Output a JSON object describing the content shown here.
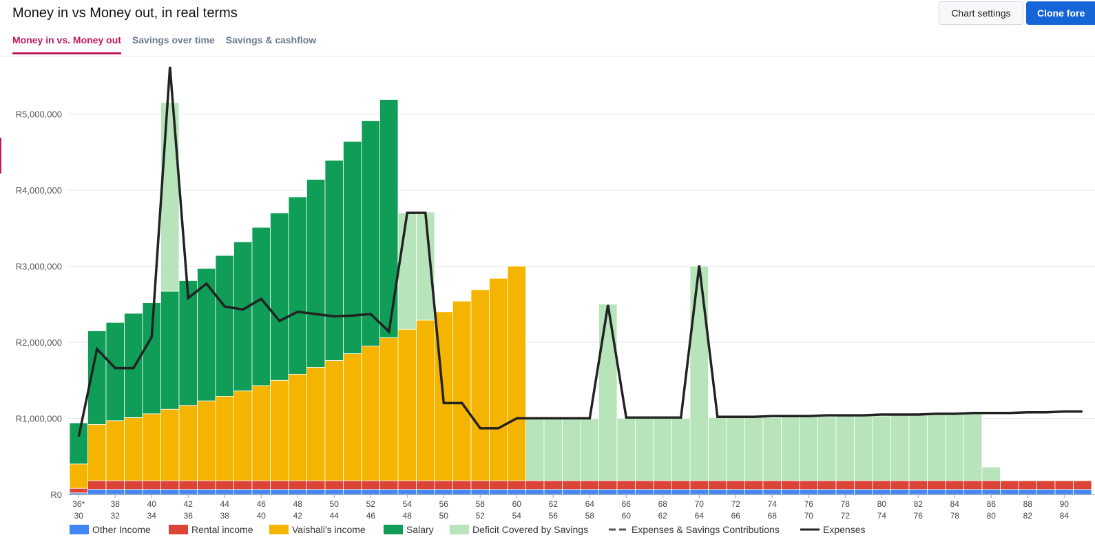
{
  "header": {
    "title": "Money in vs Money out, in real terms",
    "settings_label": "Chart settings",
    "clone_label": "Clone fore"
  },
  "tabs": [
    {
      "label": "Money in vs. Money out",
      "active": true
    },
    {
      "label": "Savings over time",
      "active": false
    },
    {
      "label": "Savings & cashflow",
      "active": false
    }
  ],
  "colors": {
    "other_income": "#4285f4",
    "rental_income": "#db4437",
    "vaishali_income": "#f4b400",
    "salary": "#0f9d58",
    "deficit": "#b7e4bb",
    "expenses": "#222222",
    "accent": "#c2185b",
    "button_primary": "#1565d8"
  },
  "chart_data": {
    "type": "bar",
    "title": "Money in vs Money out, in real terms",
    "ylim": [
      0,
      5700000
    ],
    "yticks": [
      {
        "value": 0,
        "label": "R0"
      },
      {
        "value": 1000000,
        "label": "R1,000,000"
      },
      {
        "value": 2000000,
        "label": "R2,000,000"
      },
      {
        "value": 3000000,
        "label": "R3,000,000"
      },
      {
        "value": 4000000,
        "label": "R4,000,000"
      },
      {
        "value": 5000000,
        "label": "R5,000,000"
      }
    ],
    "ages": [
      36,
      37,
      38,
      39,
      40,
      41,
      42,
      43,
      44,
      45,
      46,
      47,
      48,
      49,
      50,
      51,
      52,
      53,
      54,
      55,
      56,
      57,
      58,
      59,
      60,
      61,
      62,
      63,
      64,
      65,
      66,
      67,
      68,
      69,
      70,
      71,
      72,
      73,
      74,
      75,
      76,
      77,
      78,
      79,
      80,
      81,
      82,
      83,
      84,
      85,
      86,
      87,
      88,
      89,
      90,
      91
    ],
    "xtick_labels_top": [
      "36*",
      "38",
      "40",
      "42",
      "44",
      "46",
      "48",
      "50",
      "52",
      "54",
      "56",
      "58",
      "60",
      "62",
      "64",
      "66",
      "68",
      "70",
      "72",
      "74",
      "76",
      "78",
      "80",
      "82",
      "84",
      "86",
      "88",
      "90"
    ],
    "xtick_labels_bottom": [
      "30",
      "32",
      "34",
      "36",
      "38",
      "40",
      "42",
      "44",
      "46",
      "48",
      "50",
      "52",
      "54",
      "56",
      "58",
      "60",
      "62",
      "64",
      "66",
      "68",
      "70",
      "72",
      "74",
      "76",
      "78",
      "80",
      "82",
      "84"
    ],
    "series": [
      {
        "name": "Other Income",
        "values": [
          20000,
          65000,
          65000,
          65000,
          65000,
          65000,
          65000,
          65000,
          65000,
          65000,
          65000,
          65000,
          65000,
          65000,
          65000,
          65000,
          65000,
          65000,
          65000,
          65000,
          65000,
          65000,
          65000,
          65000,
          65000,
          65000,
          65000,
          65000,
          65000,
          65000,
          65000,
          65000,
          65000,
          65000,
          65000,
          65000,
          65000,
          65000,
          65000,
          65000,
          65000,
          65000,
          65000,
          65000,
          65000,
          65000,
          65000,
          65000,
          65000,
          65000,
          65000,
          65000,
          65000,
          65000,
          65000,
          65000
        ]
      },
      {
        "name": "Rental income",
        "values": [
          60000,
          115000,
          115000,
          115000,
          115000,
          115000,
          115000,
          115000,
          115000,
          115000,
          115000,
          115000,
          115000,
          115000,
          115000,
          115000,
          115000,
          115000,
          115000,
          115000,
          115000,
          115000,
          115000,
          115000,
          115000,
          115000,
          115000,
          115000,
          115000,
          115000,
          115000,
          115000,
          115000,
          115000,
          115000,
          115000,
          115000,
          115000,
          115000,
          115000,
          115000,
          115000,
          115000,
          115000,
          115000,
          115000,
          115000,
          115000,
          115000,
          115000,
          115000,
          115000,
          115000,
          115000,
          115000,
          115000
        ]
      },
      {
        "name": "Vaishali's income",
        "values": [
          320000,
          740000,
          790000,
          830000,
          880000,
          940000,
          990000,
          1050000,
          1110000,
          1180000,
          1250000,
          1320000,
          1400000,
          1490000,
          1580000,
          1670000,
          1770000,
          1880000,
          1990000,
          2110000,
          2220000,
          2360000,
          2510000,
          2660000,
          2820000,
          0,
          0,
          0,
          0,
          0,
          0,
          0,
          0,
          0,
          0,
          0,
          0,
          0,
          0,
          0,
          0,
          0,
          0,
          0,
          0,
          0,
          0,
          0,
          0,
          0,
          0,
          0,
          0,
          0,
          0,
          0
        ]
      },
      {
        "name": "Salary",
        "values": [
          540000,
          1230000,
          1290000,
          1370000,
          1460000,
          1550000,
          1640000,
          1740000,
          1850000,
          1960000,
          2080000,
          2200000,
          2330000,
          2470000,
          2630000,
          2790000,
          2960000,
          3130000,
          0,
          0,
          0,
          0,
          0,
          0,
          0,
          0,
          0,
          0,
          0,
          0,
          0,
          0,
          0,
          0,
          0,
          0,
          0,
          0,
          0,
          0,
          0,
          0,
          0,
          0,
          0,
          0,
          0,
          0,
          0,
          0,
          0,
          0,
          0,
          0,
          0,
          0
        ]
      },
      {
        "name": "Deficit Covered by Savings",
        "values": [
          0,
          0,
          0,
          0,
          0,
          2480000,
          0,
          0,
          0,
          0,
          0,
          0,
          0,
          0,
          0,
          0,
          0,
          0,
          1530000,
          1420000,
          0,
          0,
          0,
          0,
          0,
          810000,
          810000,
          810000,
          810000,
          2320000,
          820000,
          820000,
          820000,
          820000,
          2820000,
          830000,
          830000,
          830000,
          830000,
          840000,
          840000,
          840000,
          850000,
          850000,
          850000,
          860000,
          860000,
          870000,
          870000,
          880000,
          180000,
          0,
          0,
          0,
          0,
          0
        ]
      },
      {
        "name": "Expenses & Savings Contributions",
        "values": []
      },
      {
        "name": "Expenses",
        "values": [
          760000,
          1910000,
          1660000,
          1660000,
          2070000,
          5620000,
          2580000,
          2770000,
          2470000,
          2430000,
          2570000,
          2280000,
          2400000,
          2370000,
          2340000,
          2350000,
          2370000,
          2140000,
          3700000,
          3700000,
          1200000,
          1200000,
          870000,
          870000,
          1000000,
          1000000,
          1000000,
          1000000,
          1000000,
          2490000,
          1010000,
          1010000,
          1010000,
          1010000,
          3010000,
          1020000,
          1020000,
          1020000,
          1030000,
          1030000,
          1030000,
          1040000,
          1040000,
          1040000,
          1050000,
          1050000,
          1050000,
          1060000,
          1060000,
          1070000,
          1070000,
          1070000,
          1080000,
          1080000,
          1090000,
          1090000
        ]
      }
    ],
    "legend_position": "bottom",
    "grid": true
  }
}
